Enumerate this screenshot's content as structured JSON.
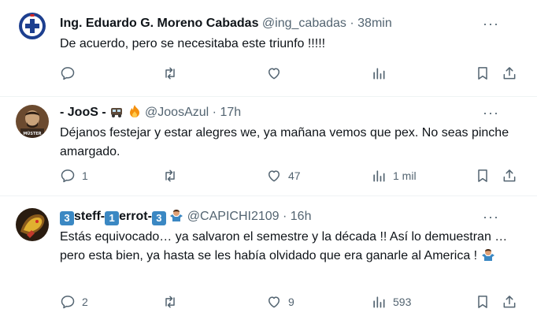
{
  "tweets": [
    {
      "name": "Ing. Eduardo G. Moreno Cabadas",
      "handle": "@ing_cabadas",
      "sep": "·",
      "time": "38min",
      "more": "···",
      "text": "De acuerdo, pero se necesitaba este triunfo !!!!!",
      "counts": {
        "replies": "",
        "retweets": "",
        "likes": "",
        "views": ""
      },
      "avatar_colors": {
        "bg": "#ffffff",
        "accent": "#1d3f8f"
      }
    },
    {
      "name": "- JooS -",
      "handle": "@JoosAzul",
      "sep": "·",
      "time": "17h",
      "more": "···",
      "text": "Déjanos festejar y estar alegres we, ya mañana vemos que pex. No seas pinche amargado.",
      "counts": {
        "replies": "1",
        "retweets": "",
        "likes": "47",
        "views": "1 mil"
      },
      "avatar_colors": {
        "bg": "#6b4a2f",
        "accent": "#c9a27a"
      }
    },
    {
      "name_parts": [
        "3",
        "steff-",
        "1",
        "errot-",
        "3"
      ],
      "handle": "@CAPICHI2109",
      "sep": "·",
      "time": "16h",
      "more": "···",
      "text": "Estás  equivocado… ya salvaron el semestre y la década !!  Así lo demuestran … pero esta bien, ya hasta se les había olvidado que era ganarle al America !",
      "counts": {
        "replies": "2",
        "retweets": "",
        "likes": "9",
        "views": "593"
      },
      "avatar_colors": {
        "bg": "#2a1c10",
        "accent": "#e0b030"
      }
    }
  ],
  "colors": {
    "text": "#0f1419",
    "muted": "#536471",
    "divider": "#eff3f4",
    "keycap": "#3b88c3"
  },
  "icons": [
    "reply-icon",
    "retweet-icon",
    "like-icon",
    "views-icon",
    "bookmark-icon",
    "share-icon",
    "more-icon"
  ]
}
